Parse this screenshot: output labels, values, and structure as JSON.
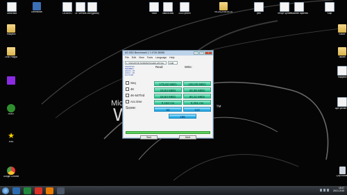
{
  "desktop": {
    "icons": [
      {
        "label": "UltraVista",
        "kind": "doc"
      },
      {
        "label": "Geleneksel",
        "kind": "app"
      },
      {
        "label": "DEDEKO",
        "kind": "doc"
      },
      {
        "label": "Dr. Service",
        "kind": "doc"
      },
      {
        "label": "Cover(global)",
        "kind": "doc"
      },
      {
        "label": "Yollar",
        "kind": "doc"
      },
      {
        "label": "Vatova falsi",
        "kind": "doc"
      },
      {
        "label": "2018 çevrim",
        "kind": "doc"
      },
      {
        "label": "VILLAÇENA ALLAKEK",
        "kind": "folder"
      },
      {
        "label": "yeni",
        "kind": "doc"
      },
      {
        "label": "Yeniçe Sphere",
        "kind": "doc"
      },
      {
        "label": "Yükselen tüplerimiz",
        "kind": "doc"
      },
      {
        "label": "Kalp",
        "kind": "doc"
      },
      {
        "label": "Hikayelili",
        "kind": "folder"
      },
      {
        "label": "Leon Playya",
        "kind": "folder"
      },
      {
        "label": "",
        "kind": "game"
      },
      {
        "label": "ROBT",
        "kind": "tree"
      },
      {
        "label": "ERA",
        "kind": "star"
      },
      {
        "label": "Google Chrome",
        "kind": "chrome"
      },
      {
        "label": "Klasör",
        "kind": "folder"
      },
      {
        "label": "Takvim",
        "kind": "folder"
      },
      {
        "label": "Hikayelili",
        "kind": "doc"
      },
      {
        "label": "Ayni çevrim'dir",
        "kind": "doc"
      },
      {
        "label": "Çöp Kutusu",
        "kind": "bin"
      }
    ]
  },
  "wallpaper": {
    "mic_text": "Mic",
    "w_text": "W",
    "tm": "™"
  },
  "app": {
    "title": "AS SSD Benchmark 1.7.4739.38088",
    "menu": [
      "File",
      "Edit",
      "View",
      "Tools",
      "Language",
      "Help"
    ],
    "drive_select": "1. KINGSTON SV300S37A120G ATA De...",
    "size_select": "1GB",
    "drive_info": [
      "KINGSTON",
      "505ABBF0",
      "iaStorA - OK",
      "1024 K - OK",
      "111.79 GB"
    ],
    "col_read": "Read:",
    "col_write": "Write:",
    "rows": [
      {
        "label": "Seq",
        "read": "175,62 MB/s",
        "write": "100,00 MB/s"
      },
      {
        "label": "4K",
        "read": "18,84 MB/s",
        "write": "40,36 MB/s"
      },
      {
        "label": "4K-64Thrd",
        "read": "18,84 MB/s",
        "write": "60,11 MB/s"
      },
      {
        "label": "Acc.time",
        "read": "0,160 ms",
        "write": "0,261 ms"
      }
    ],
    "score_label": "Score:",
    "score_read": "53",
    "score_write": "110",
    "score_total": "195",
    "progress": 1.0,
    "start_btn": "Start",
    "abort_btn": "Abort"
  },
  "taskbar": {
    "time": "15:37",
    "date": "28.01.2015",
    "apps": [
      {
        "name": "explorer",
        "color": "#2b6cb0"
      },
      {
        "name": "media",
        "color": "#1f8a3b"
      },
      {
        "name": "chrome",
        "color": "#d93025"
      },
      {
        "name": "media-player",
        "color": "#e87a00"
      },
      {
        "name": "as-ssd",
        "color": "#4a5566"
      }
    ]
  }
}
